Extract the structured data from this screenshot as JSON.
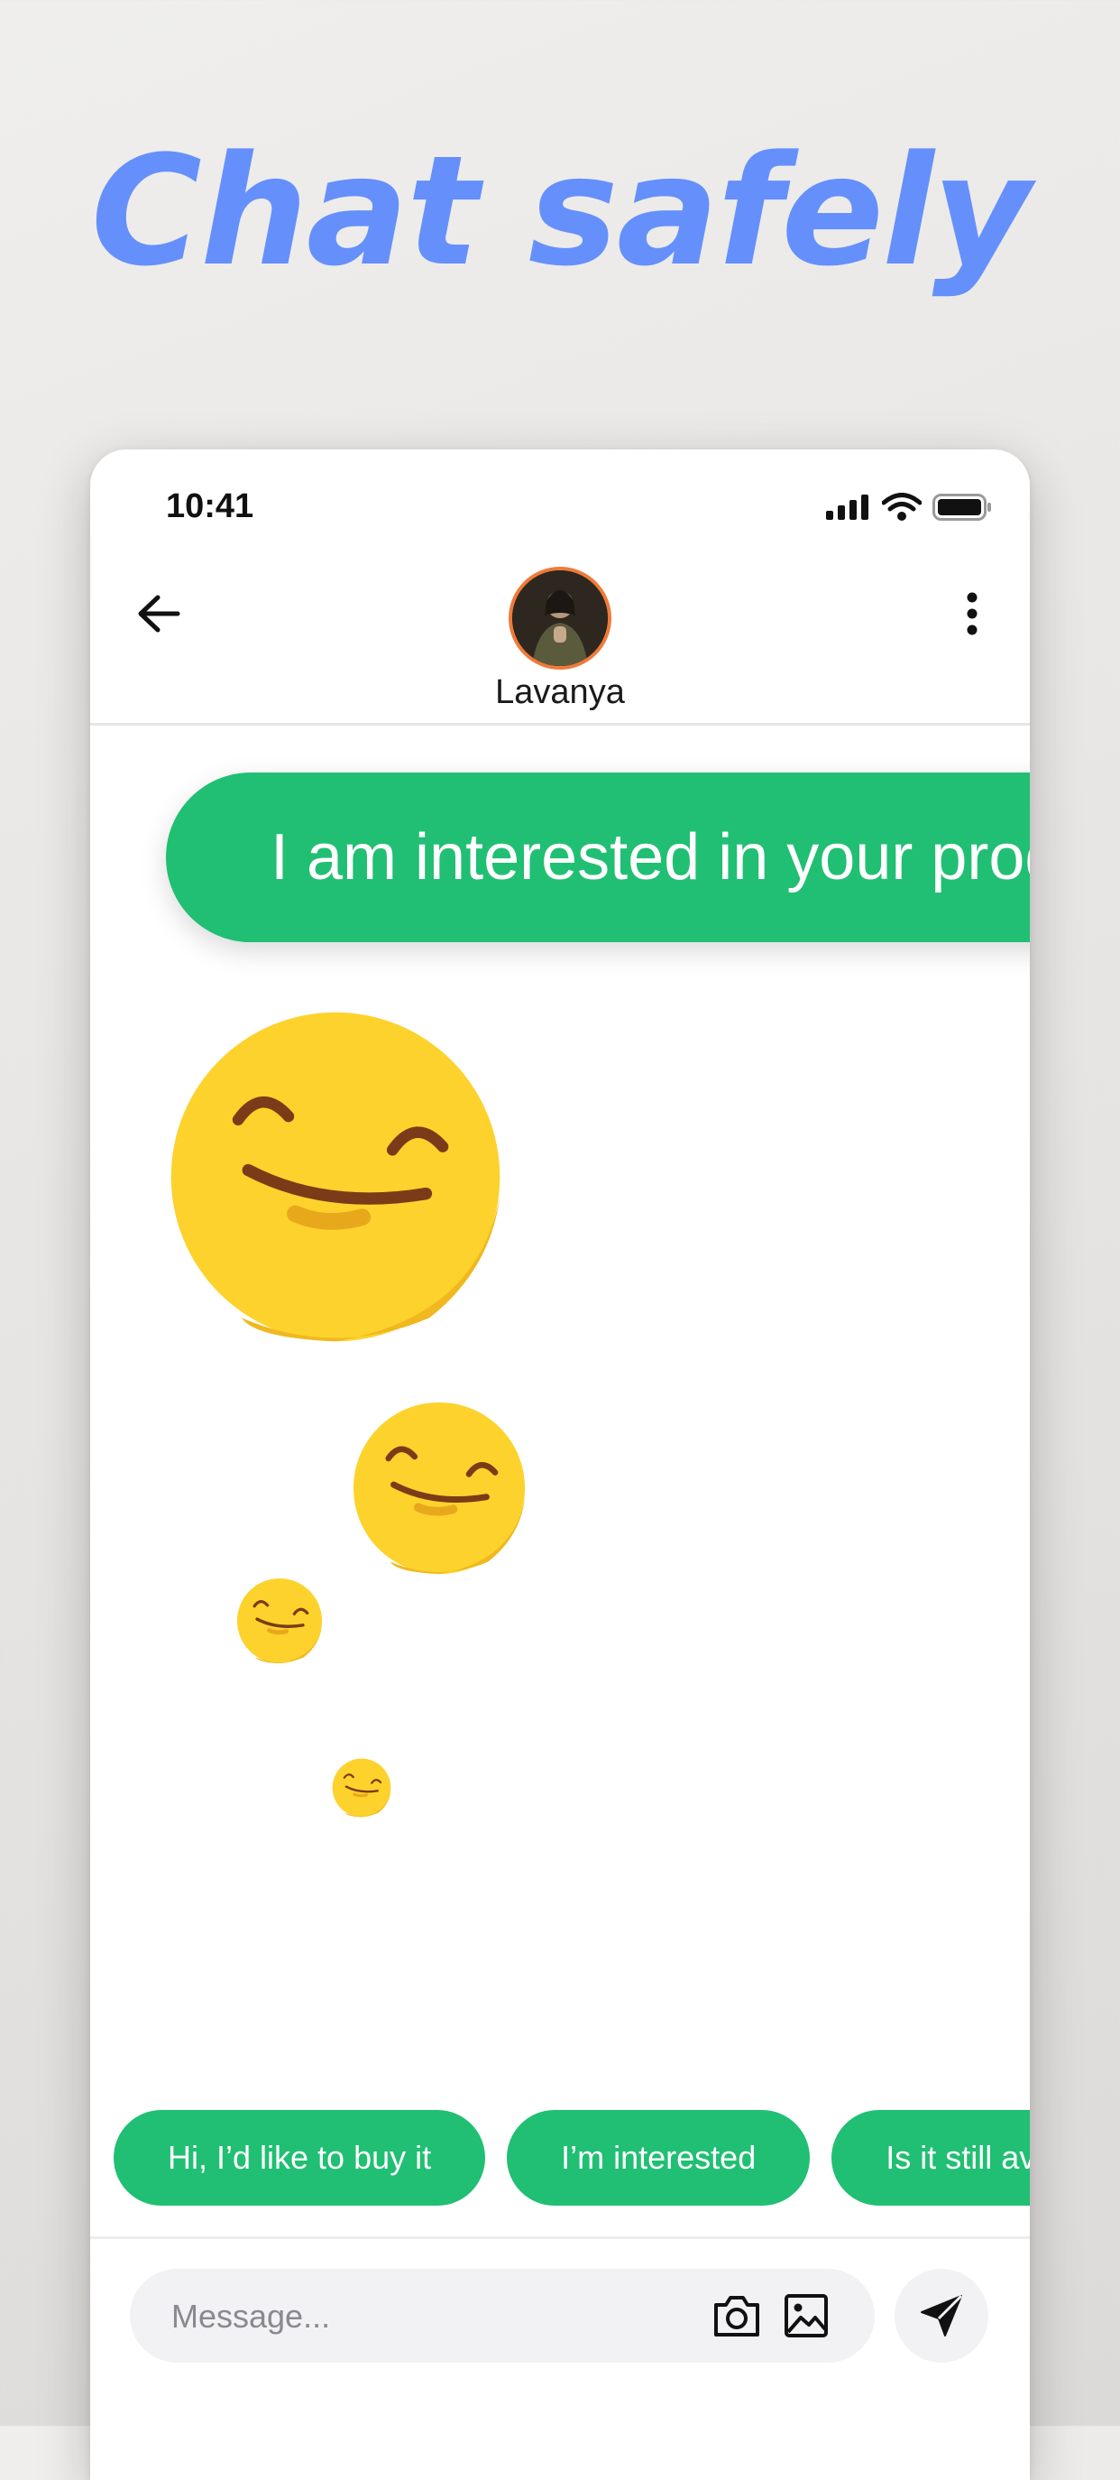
{
  "headline": "Chat safely",
  "status_bar": {
    "time": "10:41",
    "signal_icon": "cellular-signal-icon",
    "wifi_icon": "wifi-icon",
    "battery_icon": "battery-icon"
  },
  "header": {
    "back_icon": "arrow-left-icon",
    "contact_name": "Lavanya",
    "more_icon": "more-vertical-icon"
  },
  "message": {
    "text": "I am interested in your product"
  },
  "emoji_icon": "smiling-face-icon",
  "quick_replies": [
    "Hi, I’d like to buy it",
    "I’m interested",
    "Is it still available?"
  ],
  "composer": {
    "placeholder": "Message...",
    "camera_icon": "camera-icon",
    "image_icon": "image-icon",
    "send_icon": "send-icon"
  },
  "colors": {
    "headline": "#6590fb",
    "accent_green": "#21bf73",
    "avatar_ring": "#f07a3a",
    "emoji_yellow": "#fdd22c",
    "input_background": "#f2f2f4"
  }
}
